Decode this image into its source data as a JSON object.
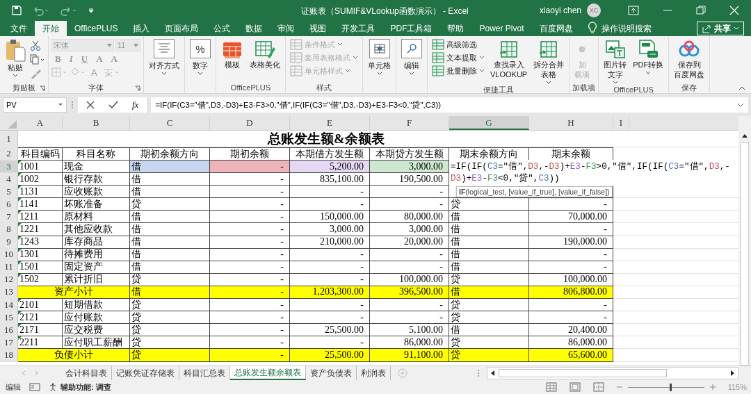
{
  "window": {
    "title": "证账表（SUMIF&VLookup函数演示） - Excel",
    "user": "xiaoyi chen",
    "avatar": "XC"
  },
  "tabs": [
    {
      "label": "文件",
      "selected": false
    },
    {
      "label": "开始",
      "selected": true
    },
    {
      "label": "OfficePLUS",
      "selected": false
    },
    {
      "label": "插入",
      "selected": false
    },
    {
      "label": "页面布局",
      "selected": false
    },
    {
      "label": "公式",
      "selected": false
    },
    {
      "label": "数据",
      "selected": false
    },
    {
      "label": "审阅",
      "selected": false
    },
    {
      "label": "视图",
      "selected": false
    },
    {
      "label": "开发工具",
      "selected": false
    },
    {
      "label": "PDF工具箱",
      "selected": false
    },
    {
      "label": "帮助",
      "selected": false
    },
    {
      "label": "Power Pivot",
      "selected": false
    },
    {
      "label": "百度网盘",
      "selected": false
    }
  ],
  "tell_me": "操作说明搜索",
  "share": "共享",
  "ribbon": {
    "groups": [
      {
        "label": "剪贴板",
        "launcher": true,
        "items": [
          {
            "kind": "clipboard",
            "lines": [
              "粘贴"
            ],
            "dropdown": true
          }
        ]
      },
      {
        "label": "字体",
        "launcher": true,
        "items": [
          {
            "kind": "font",
            "font_name": "宋体",
            "font_size": "11",
            "row1": [
              "B",
              "I",
              "U",
              "A",
              "A"
            ],
            "row2": [
              "A"
            ],
            "disabled": true
          }
        ]
      },
      {
        "items": [
          {
            "kind": "large",
            "lines": [
              "对齐方式"
            ],
            "dropdown": true
          }
        ]
      },
      {
        "items": [
          {
            "kind": "large",
            "glyph": "%",
            "lines": [
              "数字"
            ],
            "dropdown": true
          }
        ]
      },
      {
        "label": "OfficePLUS",
        "items": [
          {
            "kind": "large",
            "lines": [
              "模板"
            ]
          },
          {
            "kind": "large",
            "lines": [
              "表格美化"
            ]
          }
        ]
      },
      {
        "label": "样式",
        "items": [
          {
            "kind": "stack",
            "entries": [
              {
                "label": "条件格式",
                "dropdown": true,
                "disabled": true
              },
              {
                "label": "套用表格格式",
                "dropdown": true,
                "disabled": true
              },
              {
                "label": "单元格样式",
                "dropdown": true,
                "disabled": true
              }
            ]
          }
        ]
      },
      {
        "items": [
          {
            "kind": "large",
            "lines": [
              "单元格"
            ],
            "dropdown": true
          }
        ]
      },
      {
        "items": [
          {
            "kind": "large",
            "lines": [
              "编辑"
            ],
            "dropdown": true
          }
        ]
      },
      {
        "label": "便捷工具",
        "items": [
          {
            "kind": "stack",
            "entries": [
              {
                "label": "高级筛选"
              },
              {
                "label": "文本提取",
                "dropdown": true
              },
              {
                "label": "批量删除",
                "dropdown": true
              }
            ]
          },
          {
            "kind": "large",
            "lines": [
              "查找录入",
              "VLOOKUP"
            ]
          },
          {
            "kind": "large",
            "lines": [
              "拆分合并",
              "表格"
            ],
            "dropdown": true
          }
        ]
      },
      {
        "label": "加载项",
        "items": [
          {
            "kind": "large",
            "lines": [
              "加",
              "载项"
            ],
            "disabled": true
          }
        ]
      },
      {
        "label": "OfficePLUS",
        "items": [
          {
            "kind": "large",
            "lines": [
              "图片转",
              "文字"
            ],
            "dropdown": true
          },
          {
            "kind": "large",
            "lines": [
              "PDF转换"
            ],
            "dropdown": true
          }
        ]
      },
      {
        "label": "保存",
        "items": [
          {
            "kind": "large",
            "lines": [
              "保存到",
              "百度网盘"
            ]
          }
        ]
      }
    ]
  },
  "formula_bar": {
    "name_box": "PV",
    "fx": "fx",
    "formula": "=IF(IF(C3=\"借\",D3,-D3)+E3-F3>0,\"借\",IF(IF(C3=\"借\",D3,-D3)+E3-F3<0,\"贷\",C3))"
  },
  "columns": [
    {
      "label": "A",
      "selected": false
    },
    {
      "label": "B",
      "selected": false
    },
    {
      "label": "C",
      "selected": false
    },
    {
      "label": "D",
      "selected": false
    },
    {
      "label": "E",
      "selected": false
    },
    {
      "label": "F",
      "selected": false
    },
    {
      "label": "G",
      "selected": true
    },
    {
      "label": "H",
      "selected": false
    },
    {
      "label": "I",
      "selected": false
    }
  ],
  "rows": [
    {
      "num": "1",
      "kind": "title",
      "selected": false,
      "cells": [
        "总账发生额&余额表"
      ]
    },
    {
      "num": "2",
      "kind": "header",
      "selected": false,
      "cells": [
        "科目编码",
        "科目名称",
        "期初余额方向",
        "期初余额",
        "本期借方发生额",
        "本期贷方发生额",
        "期末余额方向",
        "期末余额"
      ]
    },
    {
      "num": "3",
      "kind": "data",
      "selected": true,
      "cells": [
        "1001",
        "现金",
        {
          "text": "借",
          "color": "#c6d6ef"
        },
        {
          "text": "-",
          "color": "#eeb4ba"
        },
        {
          "text": "5,200.00",
          "color": "#e4d8f2"
        },
        {
          "text": "3,000.00",
          "color": "#cde8cf"
        },
        null,
        null
      ]
    },
    {
      "num": "4",
      "kind": "data",
      "selected": false,
      "cells": [
        "1002",
        "银行存款",
        "借",
        "-",
        "835,100.00",
        "190,500.00",
        null,
        null
      ]
    },
    {
      "num": "5",
      "kind": "data",
      "selected": false,
      "cells": [
        "1131",
        "应收账款",
        "借",
        "-",
        "-",
        "-",
        null,
        null
      ]
    },
    {
      "num": "6",
      "kind": "data",
      "selected": false,
      "cells": [
        "1141",
        "坏账准备",
        "贷",
        "-",
        "-",
        "-",
        "贷",
        "-"
      ]
    },
    {
      "num": "7",
      "kind": "data",
      "selected": false,
      "cells": [
        "1211",
        "原材料",
        "借",
        "-",
        "150,000.00",
        "80,000.00",
        "借",
        "70,000.00"
      ]
    },
    {
      "num": "8",
      "kind": "data",
      "selected": false,
      "cells": [
        "1221",
        "其他应收款",
        "借",
        "-",
        "3,000.00",
        "3,000.00",
        "借",
        "-"
      ]
    },
    {
      "num": "9",
      "kind": "data",
      "selected": false,
      "cells": [
        "1243",
        "库存商品",
        "借",
        "-",
        "210,000.00",
        "20,000.00",
        "借",
        "190,000.00"
      ]
    },
    {
      "num": "10",
      "kind": "data",
      "selected": false,
      "cells": [
        "1301",
        "待摊费用",
        "借",
        "-",
        "-",
        "-",
        "借",
        "-"
      ]
    },
    {
      "num": "11",
      "kind": "data",
      "selected": false,
      "cells": [
        "1501",
        "固定资产",
        "借",
        "-",
        "-",
        "-",
        "借",
        "-"
      ]
    },
    {
      "num": "12",
      "kind": "data",
      "selected": false,
      "cells": [
        "1502",
        "累计折旧",
        "贷",
        "-",
        "-",
        "100,000.00",
        "贷",
        "100,000.00"
      ]
    },
    {
      "num": "13",
      "kind": "subtotal",
      "selected": false,
      "cells": [
        "资产小计",
        "借",
        "-",
        "1,203,300.00",
        "396,500.00",
        "借",
        "806,800.00"
      ]
    },
    {
      "num": "14",
      "kind": "data",
      "selected": false,
      "cells": [
        "2101",
        "短期借款",
        "贷",
        "-",
        "-",
        "-",
        "贷",
        "-"
      ]
    },
    {
      "num": "15",
      "kind": "data",
      "selected": false,
      "cells": [
        "2121",
        "应付账款",
        "贷",
        "-",
        "-",
        "-",
        "贷",
        "-"
      ]
    },
    {
      "num": "16",
      "kind": "data",
      "selected": false,
      "cells": [
        "2171",
        "应交税费",
        "贷",
        "-",
        "25,500.00",
        "5,100.00",
        "借",
        "20,400.00"
      ]
    },
    {
      "num": "17",
      "kind": "data",
      "selected": false,
      "cells": [
        "2211",
        "应付职工薪酬",
        "贷",
        "-",
        "-",
        "86,000.00",
        "贷",
        "86,000.00"
      ]
    },
    {
      "num": "18",
      "kind": "subtotal",
      "selected": false,
      "cells": [
        "负债小计",
        "贷",
        "-",
        "25,500.00",
        "91,100.00",
        "贷",
        "65,600.00"
      ]
    }
  ],
  "cell_editor": {
    "lines": [
      [
        {
          "text": "=IF(IF("
        },
        {
          "text": "C3",
          "color": "#4a72c4"
        },
        {
          "text": "=\"借\","
        },
        {
          "text": "D3",
          "color": "#c0505a"
        },
        {
          "text": ",-"
        },
        {
          "text": "D3",
          "color": "#c0505a"
        },
        {
          "text": ")+"
        },
        {
          "text": "E3",
          "color": "#8e62c0"
        },
        {
          "text": "-"
        },
        {
          "text": "F3",
          "color": "#3a9a4a"
        },
        {
          "text": ">0,\"借\",IF(IF("
        },
        {
          "text": "C3",
          "color": "#4a72c4"
        },
        {
          "text": "=\"借\","
        },
        {
          "text": "D3",
          "color": "#c0505a"
        },
        {
          "text": ",-"
        }
      ],
      [
        {
          "text": "D3",
          "color": "#c0505a"
        },
        {
          "text": ")+"
        },
        {
          "text": "E3",
          "color": "#8e62c0"
        },
        {
          "text": "-"
        },
        {
          "text": "F3",
          "color": "#3a9a4a"
        },
        {
          "text": "<0,\"贷\","
        },
        {
          "text": "C3",
          "color": "#4a72c4"
        },
        {
          "text": "))"
        }
      ]
    ],
    "tooltip": "**IF**(logical_test, [value_if_true], [value_if_false])"
  },
  "sheet_tabs": [
    {
      "label": "会计科目表",
      "selected": false
    },
    {
      "label": "记账凭证存储表",
      "selected": false
    },
    {
      "label": "科目汇总表",
      "selected": false
    },
    {
      "label": "总账发生额余额表",
      "selected": true
    },
    {
      "label": "资产负债表",
      "selected": false
    },
    {
      "label": "利润表",
      "selected": false
    }
  ],
  "status_bar": {
    "mode": "编辑",
    "accessibility": "辅助功能: 调查",
    "zoom": {
      "level": 0.55,
      "reading": "115%"
    }
  }
}
